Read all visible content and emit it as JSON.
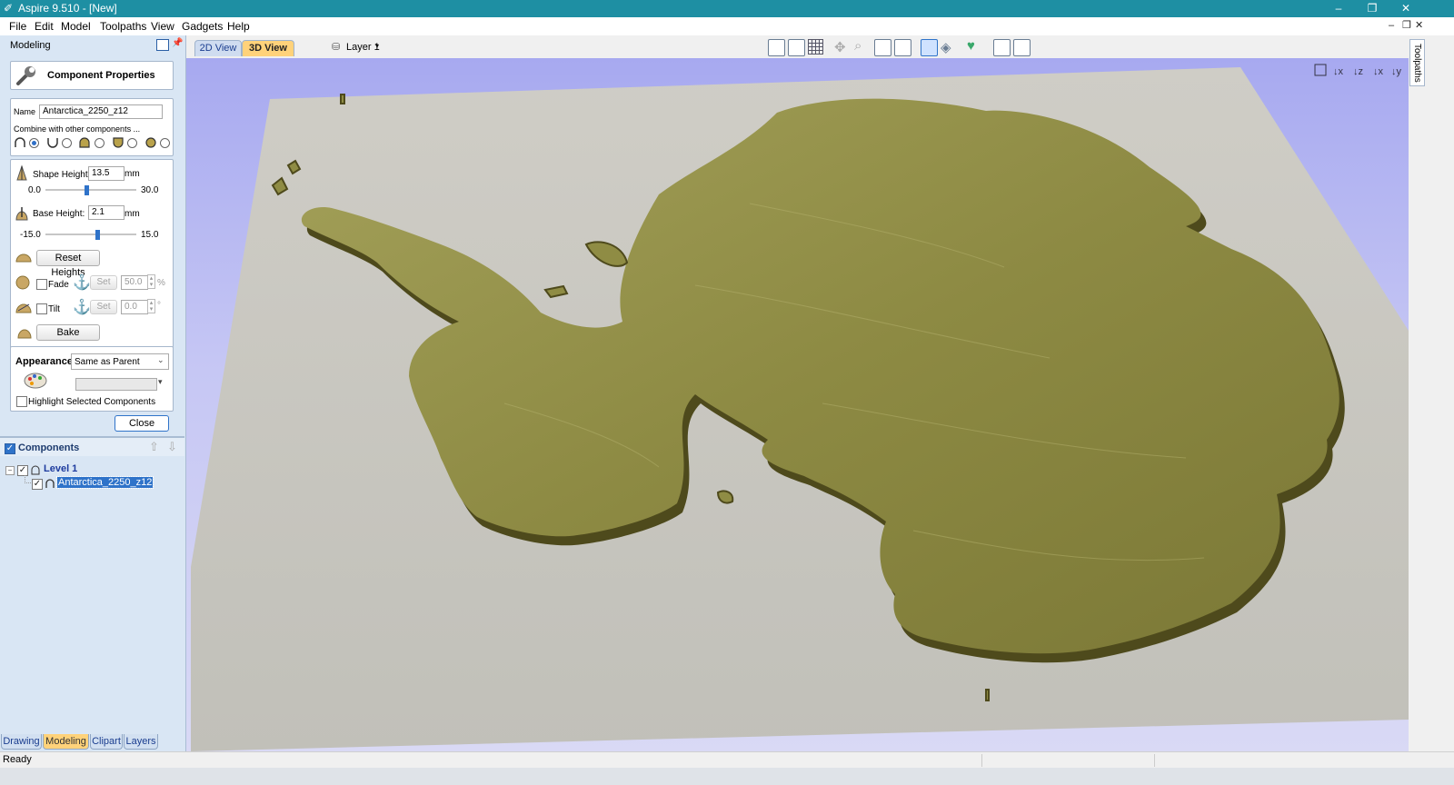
{
  "window": {
    "title": "Aspire 9.510 - [New]",
    "minimize": "–",
    "restore": "❐",
    "close": "✕"
  },
  "menubar": {
    "items": [
      "File",
      "Edit",
      "Model",
      "Toolpaths",
      "View",
      "Gadgets",
      "Help"
    ],
    "mdi_controls": [
      "–",
      "❐",
      "✕"
    ]
  },
  "modeling_panel": {
    "header": "Modeling",
    "component_properties": {
      "title": "Component Properties",
      "name_label": "Name",
      "name_value": "Antarctica_2250_z12",
      "combine_label": "Combine with other components ...",
      "combine_mode_selected": "add"
    },
    "shape_height": {
      "label": "Shape Height:",
      "value": "13.5",
      "unit": "mm",
      "min": "0.0",
      "max": "30.0",
      "level": 13.5
    },
    "base_height": {
      "label": "Base Height:",
      "value": "2.1",
      "unit": "mm",
      "min": "-15.0",
      "max": "15.0",
      "level": 2.1
    },
    "reset_heights": "Reset Heights",
    "fade": {
      "label": "Fade",
      "set": "Set",
      "value": "50.0",
      "unit": "%"
    },
    "tilt": {
      "label": "Tilt",
      "set": "Set",
      "value": "0.0",
      "unit": "°"
    },
    "bake": "Bake",
    "appearance": {
      "label": "Appearance",
      "selected": "Same as Parent"
    },
    "highlight_label": "Highlight Selected Components",
    "close": "Close"
  },
  "components_tree": {
    "title": "Components",
    "level": "Level 1",
    "item": "Antarctica_2250_z12"
  },
  "bottom_tabs": [
    "Drawing",
    "Modeling",
    "Clipart",
    "Layers"
  ],
  "view_tabs": {
    "tab_2d": "2D View",
    "tab_3d": "3D View",
    "layer": "Layer 1"
  },
  "right_strip": {
    "label": "Toolpaths"
  },
  "status": {
    "text": "Ready"
  },
  "colors": {
    "title_bar": "#1e8fa3",
    "panel_bg": "#d9e6f4",
    "model": "#8e8b3f",
    "plane": "#c4c3bc",
    "viewport_bg": "#b5b6f2",
    "active_tab": "#ffd27a"
  }
}
